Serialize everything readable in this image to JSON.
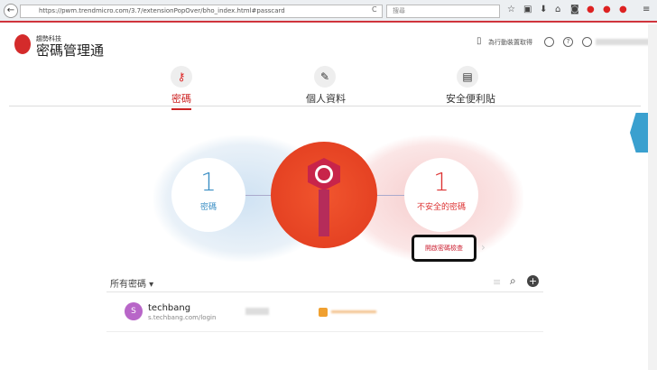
{
  "browser": {
    "url": "https://pwm.trendmicro.com/3.7/extensionPopOver/bho_index.html#passcard",
    "search_placeholder": "搜尋",
    "back": "←",
    "reload": "C"
  },
  "header": {
    "brand_small": "趨勢科技",
    "brand": "密碼管理通",
    "mobile_link": "為行動裝置取得",
    "help": "?"
  },
  "tabs": [
    {
      "label": "密碼",
      "icon": "key-icon",
      "active": true
    },
    {
      "label": "個人資料",
      "icon": "id-icon"
    },
    {
      "label": "安全便利貼",
      "icon": "note-lock-icon"
    }
  ],
  "stats": {
    "passwords_count": "1",
    "passwords_label": "密碼",
    "unsafe_count": "1",
    "unsafe_label": "不安全的密碼",
    "check_button": "開啟密碼檢查"
  },
  "list": {
    "filter": "所有密碼 ▾",
    "items": [
      {
        "initial": "S",
        "name": "techbang",
        "site": "s.techbang.com/login"
      }
    ]
  },
  "colors": {
    "accent": "#d0343c",
    "blue": "#3a8ec4",
    "avatar": "#b866c8"
  }
}
